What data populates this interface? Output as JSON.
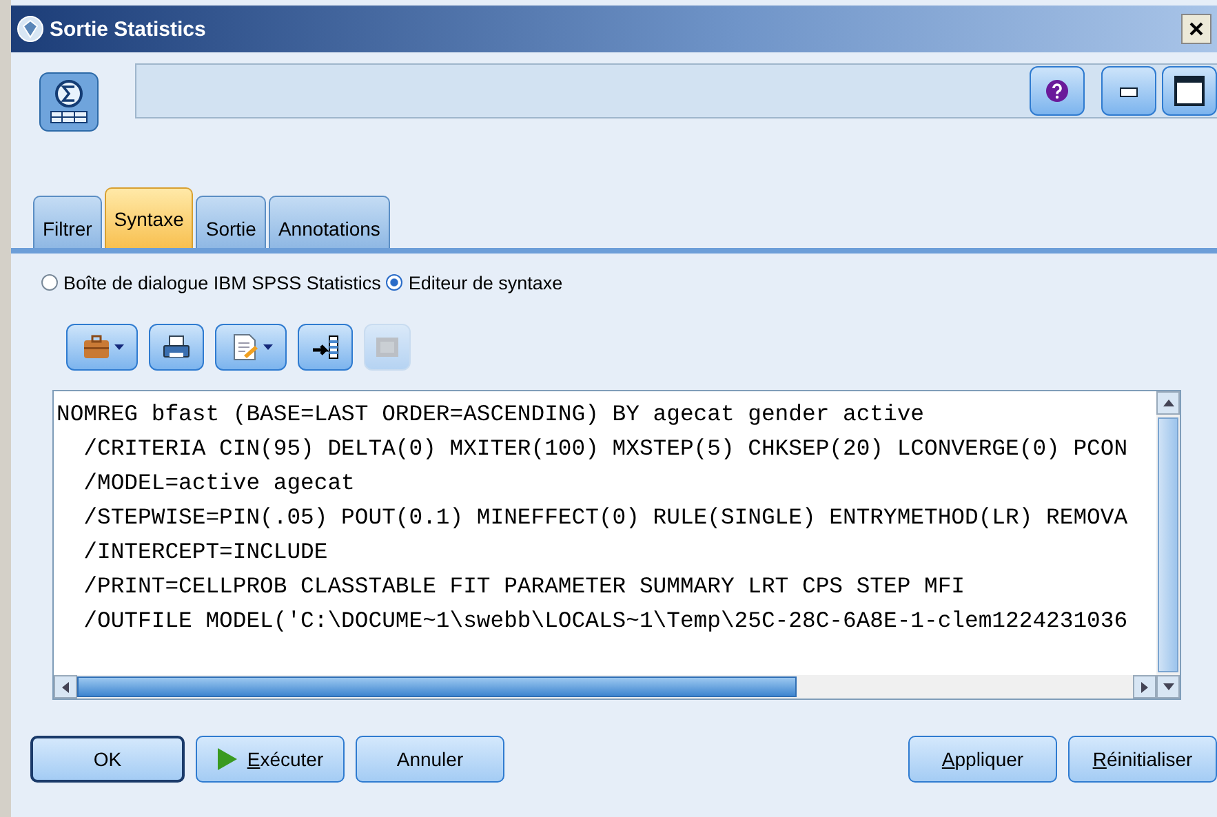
{
  "window": {
    "title": "Sortie Statistics"
  },
  "tabs": [
    {
      "label": "Filtrer",
      "selected": false
    },
    {
      "label": "Syntaxe",
      "selected": true
    },
    {
      "label": "Sortie",
      "selected": false
    },
    {
      "label": "Annotations",
      "selected": false
    }
  ],
  "mode_options": [
    {
      "label": "Boîte de dialogue IBM SPSS Statistics",
      "selected": false
    },
    {
      "label": "Editeur de syntaxe",
      "selected": true
    }
  ],
  "toolbar": [
    {
      "kind": "briefcase",
      "dropdown": true,
      "disabled": false
    },
    {
      "kind": "print",
      "dropdown": false,
      "disabled": false
    },
    {
      "kind": "edit",
      "dropdown": true,
      "disabled": false
    },
    {
      "kind": "insert",
      "dropdown": false,
      "disabled": false
    },
    {
      "kind": "panel",
      "dropdown": false,
      "disabled": true
    }
  ],
  "editor": {
    "lines": [
      "NOMREG bfast (BASE=LAST ORDER=ASCENDING) BY agecat gender active",
      "  /CRITERIA CIN(95) DELTA(0) MXITER(100) MXSTEP(5) CHKSEP(20) LCONVERGE(0) PCON",
      "  /MODEL=active agecat",
      "  /STEPWISE=PIN(.05) POUT(0.1) MINEFFECT(0) RULE(SINGLE) ENTRYMETHOD(LR) REMOVA",
      "  /INTERCEPT=INCLUDE",
      "  /PRINT=CELLPROB CLASSTABLE FIT PARAMETER SUMMARY LRT CPS STEP MFI",
      "  /OUTFILE MODEL('C:\\DOCUME~1\\swebb\\LOCALS~1\\Temp\\25C-28C-6A8E-1-clem1224231036"
    ]
  },
  "buttons_left": [
    {
      "label": "OK",
      "kind": "default",
      "mnemonic": false
    },
    {
      "label": "Exécuter",
      "kind": "run",
      "mnemonic": true
    },
    {
      "label": "Annuler",
      "kind": "plain",
      "mnemonic": false
    }
  ],
  "buttons_right": [
    {
      "label": "Appliquer",
      "mnemonic": true
    },
    {
      "label": "Réinitialiser",
      "mnemonic": true
    }
  ]
}
